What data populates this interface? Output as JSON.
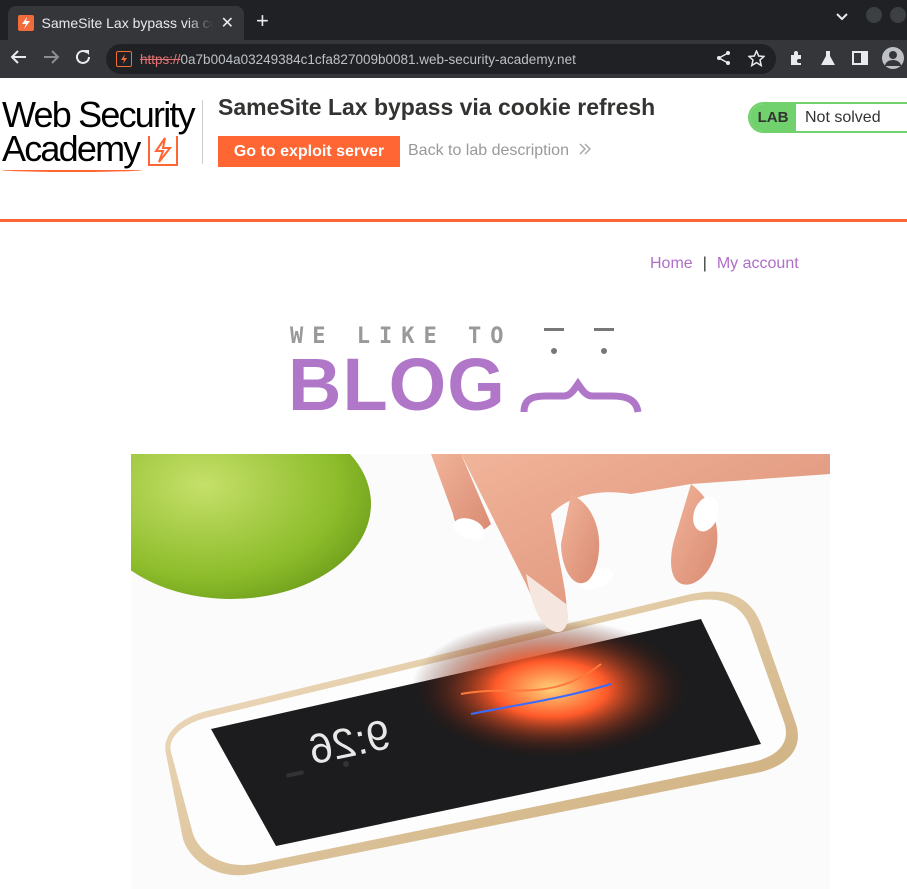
{
  "browser": {
    "tab_title": "SameSite Lax bypass via cookie refresh",
    "url_scheme": "https://",
    "url_rest": "0a7b004a03249384c1cfa827009b0081.web-security-academy.net",
    "colors": {
      "chrome_dark": "#202124",
      "chrome_mid": "#35363a"
    }
  },
  "lab": {
    "logo_line1": "Web Security",
    "logo_line2": "Academy",
    "title": "SameSite Lax bypass via cookie refresh",
    "exploit_button": "Go to exploit server",
    "back_link": "Back to lab description",
    "status_badge": "LAB",
    "status_text": "Not solved",
    "colors": {
      "accent": "#ff6633",
      "status_green": "#70d16d"
    }
  },
  "nav": {
    "home": "Home",
    "separator": "|",
    "my_account": "My account",
    "link_color": "#b06ec6"
  },
  "blog": {
    "tagline": "WE LIKE TO",
    "wordmark": "BLOG",
    "brand_color": "#b077c9"
  },
  "hero": {
    "phone_time": "9:26"
  }
}
